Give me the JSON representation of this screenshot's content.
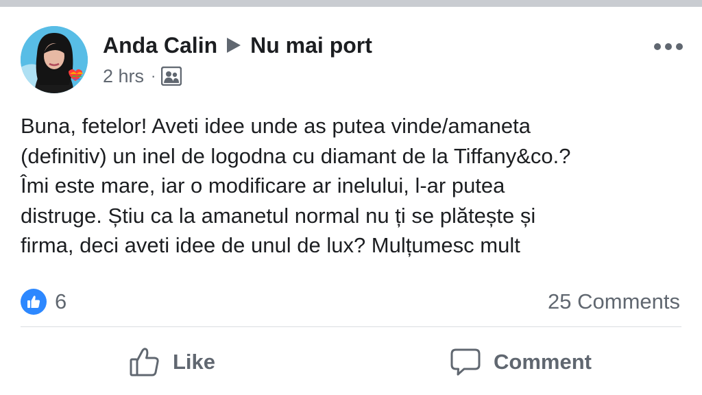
{
  "post": {
    "author": "Anda Calin",
    "group": "Nu mai port",
    "time": "2 hrs",
    "separator": "·",
    "audience_icon": "group-members-icon",
    "text_lines": [
      "Buna, fetelor! Aveti idee unde as putea vinde/amaneta",
      "(definitiv) un inel de logodna cu diamant de la Tiffany&co.?",
      "Îmi este mare, iar o modificare ar inelului, l-ar putea",
      "distruge. Știu ca la amanetul normal nu ți se plătește și",
      "firma, deci aveti idee de unul de lux? Mulțumesc mult"
    ],
    "likes": "6",
    "comments": "25 Comments"
  },
  "actions": {
    "like_label": "Like",
    "comment_label": "Comment"
  },
  "colors": {
    "text": "#1c1e21",
    "secondary": "#606770",
    "like_blue": "#2d88ff",
    "divider": "#dadde1"
  }
}
